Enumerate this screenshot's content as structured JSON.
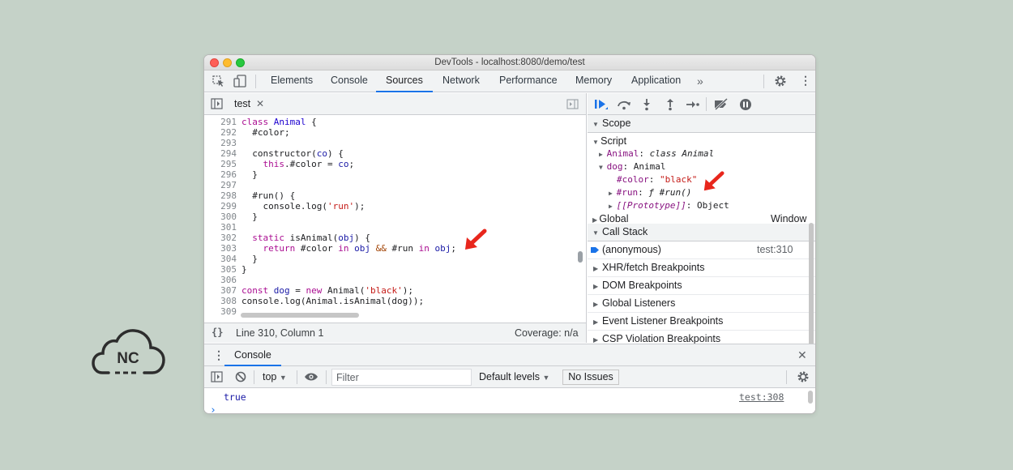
{
  "window": {
    "title": "DevTools - localhost:8080/demo/test"
  },
  "tabs": [
    "Elements",
    "Console",
    "Sources",
    "Network",
    "Performance",
    "Memory",
    "Application"
  ],
  "active_tab": "Sources",
  "editor": {
    "file_tab": "test",
    "line_numbers": [
      "291",
      "292",
      "293",
      "294",
      "295",
      "296",
      "297",
      "298",
      "299",
      "300",
      "301",
      "302",
      "303",
      "304",
      "305",
      "306",
      "307",
      "308",
      "309"
    ],
    "status": "Line 310, Column 1",
    "coverage": "Coverage: n/a"
  },
  "scope": {
    "title": "Scope",
    "script_label": "Script",
    "animal_key": "Animal",
    "animal_val": "class Animal",
    "dog_key": "dog",
    "dog_val": "Animal",
    "color_key": "#color",
    "color_val": "\"black\"",
    "run_key": "#run",
    "run_val": "ƒ #run()",
    "proto_key": "[[Prototype]]",
    "proto_val": "Object",
    "global_label": "Global",
    "global_val": "Window"
  },
  "call_stack": {
    "title": "Call Stack",
    "frame": "(anonymous)",
    "location": "test:310"
  },
  "breakpoints": [
    "XHR/fetch Breakpoints",
    "DOM Breakpoints",
    "Global Listeners",
    "Event Listener Breakpoints",
    "CSP Violation Breakpoints"
  ],
  "console": {
    "title": "Console",
    "context": "top",
    "filter_placeholder": "Filter",
    "levels": "Default levels",
    "issues": "No Issues",
    "output": "true",
    "output_source": "test:308",
    "prompt": "›"
  },
  "colors": {
    "accent": "#1a73e8",
    "arrow": "#e8261c"
  }
}
